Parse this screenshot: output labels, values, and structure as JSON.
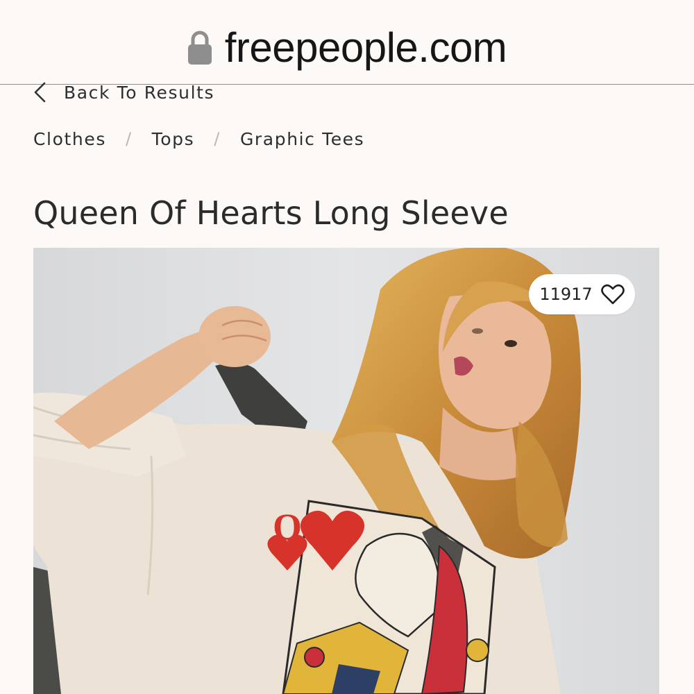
{
  "browser": {
    "url": "freepeople.com",
    "lock_icon": "lock-icon"
  },
  "nav": {
    "back_label": "Back To Results",
    "back_icon": "chevron-left-icon"
  },
  "breadcrumb": {
    "items": [
      "Clothes",
      "Tops",
      "Graphic Tees"
    ],
    "separator": "/"
  },
  "product": {
    "title": "Queen Of Hearts Long Sleeve",
    "favorites_count": "11917",
    "favorite_icon": "heart-outline-icon",
    "image_alt": "Model wearing cream long sleeve tee with queen of hearts card graphic",
    "graphic_letter": "Q"
  },
  "colors": {
    "background": "#fdf9f6",
    "text": "#2a2a2a",
    "heart_red": "#d6342b"
  }
}
